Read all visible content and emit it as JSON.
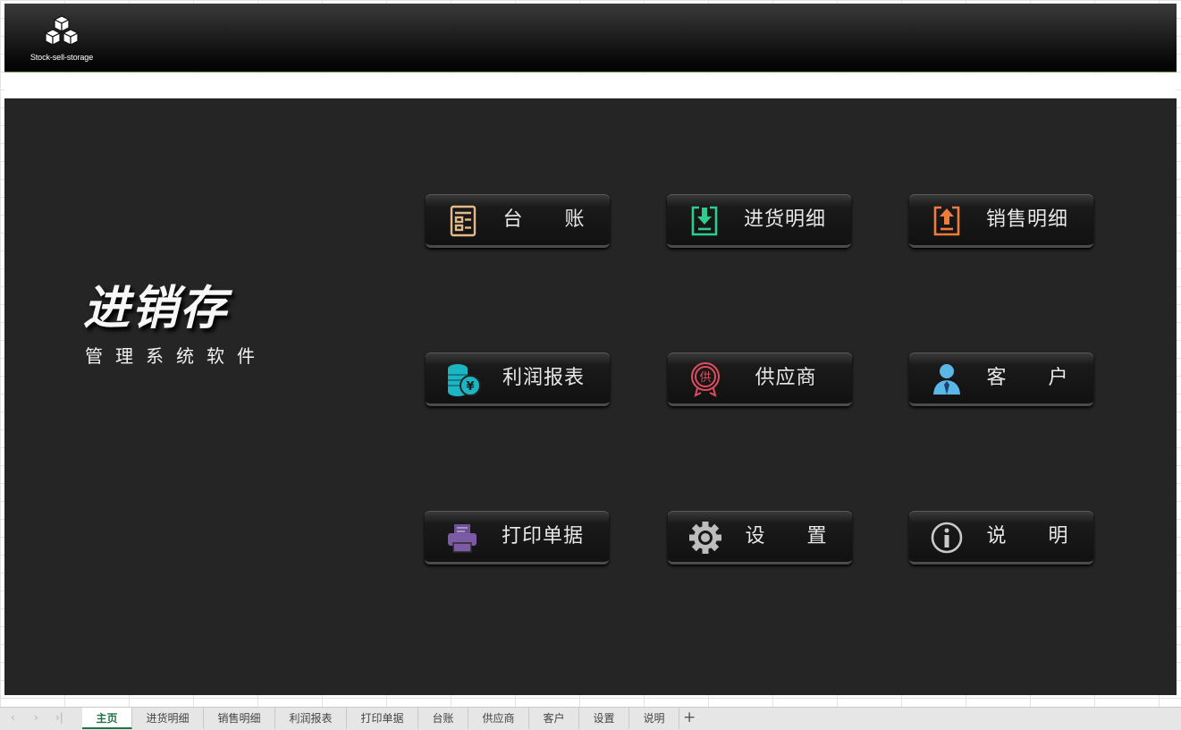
{
  "header": {
    "logo_text": "Stock-sell-storage"
  },
  "brand": {
    "title": "进销存",
    "subtitle": "管理系统软件"
  },
  "buttons": [
    {
      "id": "ledger",
      "label": "台 账",
      "icon": "ledger-icon",
      "color": "#e3b98a"
    },
    {
      "id": "purchase",
      "label": "进货明细",
      "icon": "download-icon",
      "color": "#2ecc8f"
    },
    {
      "id": "sales",
      "label": "销售明细",
      "icon": "upload-icon",
      "color": "#f07c3c"
    },
    {
      "id": "profit",
      "label": "利润报表",
      "icon": "coins-yen-icon",
      "color": "#1bb5c4"
    },
    {
      "id": "supplier",
      "label": "供应商",
      "icon": "supplier-seal-icon",
      "color": "#e04c5f"
    },
    {
      "id": "customer",
      "label": "客 户",
      "icon": "user-icon",
      "color": "#5bb8e6"
    },
    {
      "id": "print",
      "label": "打印单据",
      "icon": "printer-icon",
      "color": "#7d5aa6"
    },
    {
      "id": "settings",
      "label": "设 置",
      "icon": "gear-icon",
      "color": "#bdbdbd"
    },
    {
      "id": "help",
      "label": "说 明",
      "icon": "info-icon",
      "color": "#c9c9c9"
    }
  ],
  "sheet_tabs": [
    "主页",
    "进货明细",
    "销售明细",
    "利润报表",
    "打印单据",
    "台账",
    "供应商",
    "客户",
    "设置",
    "说明"
  ],
  "active_tab": "主页"
}
